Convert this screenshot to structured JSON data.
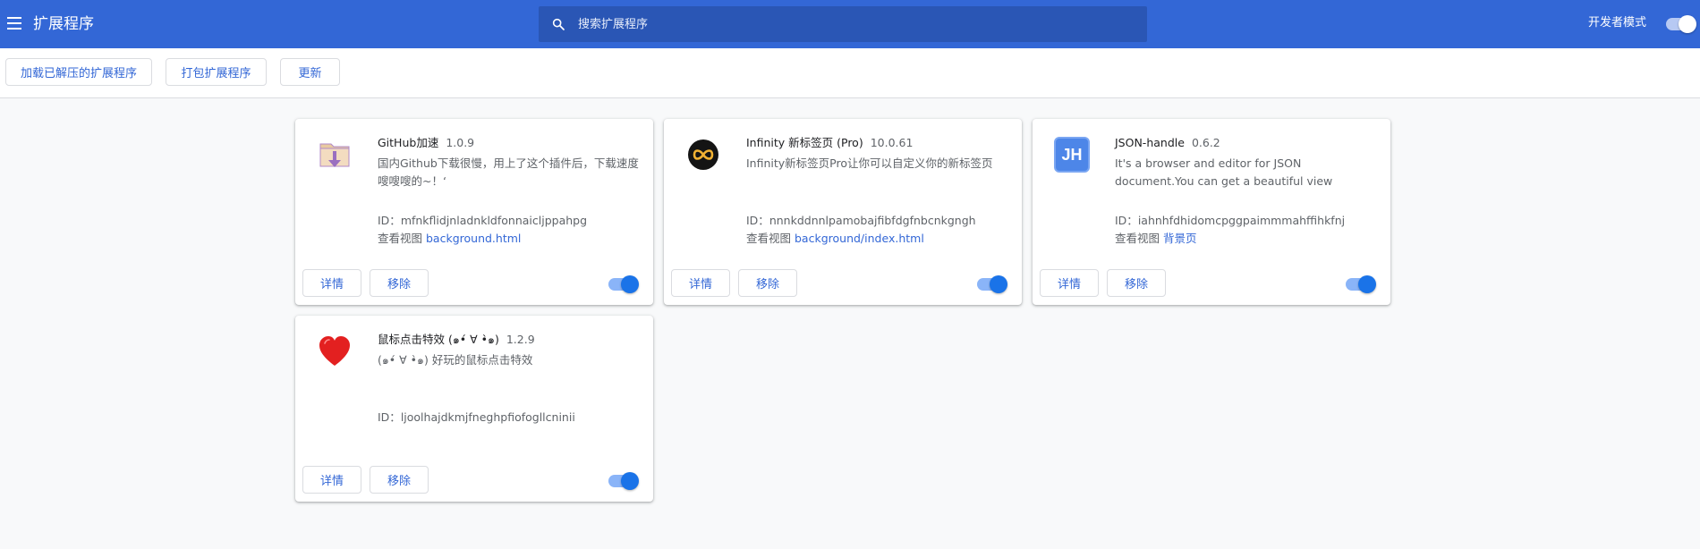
{
  "header": {
    "title": "扩展程序",
    "menu_icon": "hamburger-menu-icon",
    "search_placeholder": "搜索扩展程序",
    "search_icon": "search-icon",
    "devmode_label": "开发者模式",
    "devmode_on": true
  },
  "toolbar": {
    "load_unpacked": "加载已解压的扩展程序",
    "pack": "打包扩展程序",
    "update": "更新"
  },
  "colors": {
    "header_bg": "#3367d6",
    "accent": "#1a73e8",
    "toggle_track": "#8ab4f8"
  },
  "extensions": [
    {
      "name": "GitHub加速",
      "version": "1.0.9",
      "description": "国内Github下载很慢，用上了这个插件后，下载速度嗖嗖嗖的~！‘",
      "id_label": "ID：",
      "id": "mfnkflidjnladnkldfonnaicljppahpg",
      "views_label": "查看视图",
      "view_link": "background.html",
      "icon": "download-folder-icon",
      "details": "详情",
      "remove": "移除",
      "enabled": true
    },
    {
      "name": "Infinity 新标签页 (Pro)",
      "version": "10.0.61",
      "description": "Infinity新标签页Pro让你可以自定义你的新标签页",
      "id_label": "ID：",
      "id": "nnnkddnnlpamobajfibfdgfnbcnkgngh",
      "views_label": "查看视图",
      "view_link": "background/index.html",
      "icon": "infinity-icon",
      "details": "详情",
      "remove": "移除",
      "enabled": true
    },
    {
      "name": "JSON-handle",
      "version": "0.6.2",
      "description": "It's a browser and editor for JSON document.You can get a beautiful view",
      "id_label": "ID：",
      "id": "iahnhfdhidomcpggpaimmmahffihkfnj",
      "views_label": "查看视图",
      "view_link": "背景页",
      "icon": "jh-logo-icon",
      "icon_text": "JH",
      "details": "详情",
      "remove": "移除",
      "enabled": true
    },
    {
      "name": "鼠标点击特效 (๑•́ ∀ •̀๑)",
      "version": "1.2.9",
      "description": "(๑•́ ∀ •̀๑) 好玩的鼠标点击特效",
      "id_label": "ID：",
      "id": "ljoolhajdkmjfneghpfiofogllcninii",
      "icon": "heart-icon",
      "details": "详情",
      "remove": "移除",
      "enabled": true
    }
  ]
}
